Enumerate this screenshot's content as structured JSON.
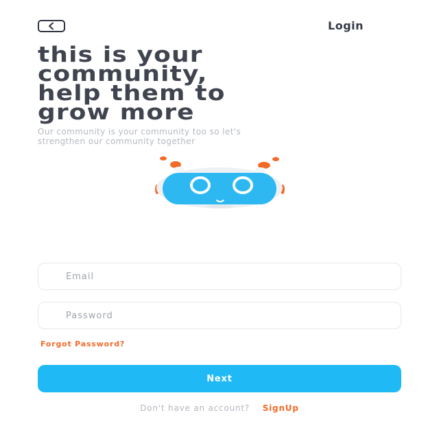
{
  "header": {
    "back_icon": "chevron-left-icon",
    "login_label": "Login"
  },
  "hero": {
    "title_lines": [
      "this is your",
      "community,",
      "help them to",
      "grow more"
    ],
    "subtitle_lines": [
      "Our community is your community too so let's",
      "strengthen our community together"
    ],
    "mascot_icon": "robot-mascot-icon"
  },
  "form": {
    "email_placeholder": "Email",
    "password_placeholder": "Password",
    "forgot_label": "Forgot Password?",
    "next_label": "Next"
  },
  "footer": {
    "prompt": "Don't have an account?",
    "signup_label": "SignUp"
  },
  "colors": {
    "primary": "#1fbaf5",
    "accent": "#f26a27",
    "title": "#40444f"
  }
}
